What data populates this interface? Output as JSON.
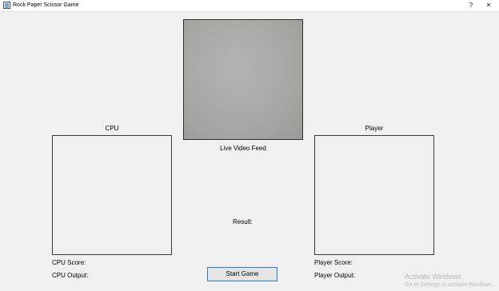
{
  "window": {
    "title": "Rock Paper Scissor Game",
    "help_label": "?",
    "close_label": "✕"
  },
  "video": {
    "label": "Live Video Feed"
  },
  "cpu": {
    "heading": "CPU",
    "score_label": "CPU Score:",
    "output_label": "CPU Output:"
  },
  "player": {
    "heading": "Player",
    "score_label": "Player Score:",
    "output_label": "Player Output:"
  },
  "result": {
    "label": "Result:"
  },
  "controls": {
    "start_label": "Start Game"
  },
  "watermark": {
    "line1": "Activate Windows",
    "line2": "Go to Settings to activate Windows."
  }
}
